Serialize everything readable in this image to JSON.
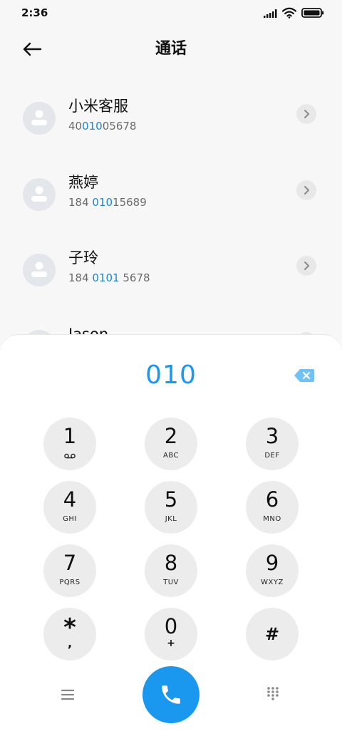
{
  "status": {
    "time": "2:36"
  },
  "header": {
    "title": "通话"
  },
  "contacts": [
    {
      "name": "小米客服",
      "number_parts": [
        "40",
        "010",
        "05678"
      ]
    },
    {
      "name": "燕婷",
      "number_parts": [
        "184 ",
        "010",
        "15689"
      ]
    },
    {
      "name": "子玲",
      "number_parts": [
        "184 ",
        "0101",
        " 5678"
      ]
    },
    {
      "name": "Jason"
    }
  ],
  "dialer": {
    "number": "010",
    "keys": [
      {
        "digit": "1",
        "letters": ""
      },
      {
        "digit": "2",
        "letters": "ABC"
      },
      {
        "digit": "3",
        "letters": "DEF"
      },
      {
        "digit": "4",
        "letters": "GHI"
      },
      {
        "digit": "5",
        "letters": "JKL"
      },
      {
        "digit": "6",
        "letters": "MNO"
      },
      {
        "digit": "7",
        "letters": "PQRS"
      },
      {
        "digit": "8",
        "letters": "TUV"
      },
      {
        "digit": "9",
        "letters": "WXYZ"
      },
      {
        "digit": "*",
        "letters": ","
      },
      {
        "digit": "0",
        "letters": "+"
      },
      {
        "digit": "#",
        "letters": ""
      }
    ]
  },
  "icons": {
    "back": "back-arrow-icon",
    "delete": "backspace-icon",
    "menu": "menu-icon",
    "call": "phone-icon",
    "dialpad": "dialpad-icon",
    "voicemail": "voicemail-icon"
  },
  "colors": {
    "accent": "#1a98ef",
    "highlight": "#1a86d8",
    "key_bg": "#ececec",
    "background": "#f7f7f7"
  }
}
